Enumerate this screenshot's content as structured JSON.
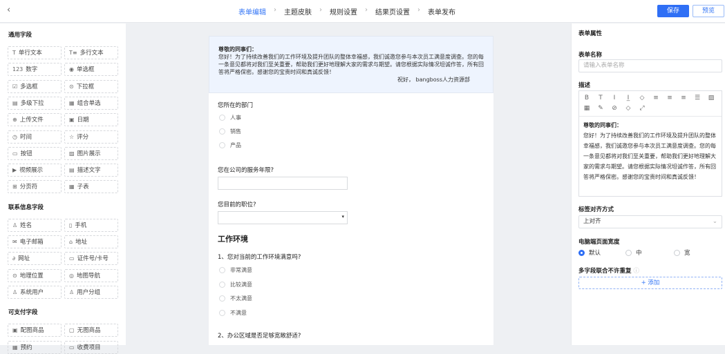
{
  "header": {
    "back": "‹",
    "steps": [
      "表单编辑",
      "主题皮肤",
      "规则设置",
      "结果页设置",
      "表单发布"
    ],
    "save": "保存",
    "preview": "预览"
  },
  "left": {
    "sections": [
      {
        "title": "通用字段",
        "items": [
          [
            "T",
            "单行文本"
          ],
          [
            "T≡",
            "多行文本"
          ],
          [
            "123",
            "数字"
          ],
          [
            "◉",
            "单选框"
          ],
          [
            "☑",
            "多选框"
          ],
          [
            "⊙",
            "下拉框"
          ],
          [
            "▤",
            "多级下拉"
          ],
          [
            "▦",
            "组合单选"
          ],
          [
            "⊕",
            "上传文件"
          ],
          [
            "▣",
            "日期"
          ],
          [
            "◷",
            "时间"
          ],
          [
            "☆",
            "评分"
          ],
          [
            "▭",
            "按钮"
          ],
          [
            "▨",
            "图片展示"
          ],
          [
            "▶",
            "视频展示"
          ],
          [
            "▤",
            "描述文字"
          ],
          [
            "⊞",
            "分页符"
          ],
          [
            "▦",
            "子表"
          ]
        ]
      },
      {
        "title": "联系信息字段",
        "items": [
          [
            "♙",
            "姓名"
          ],
          [
            "▯",
            "手机"
          ],
          [
            "✉",
            "电子邮箱"
          ],
          [
            "⌂",
            "地址"
          ],
          [
            "∂",
            "网址"
          ],
          [
            "▭",
            "证件号/卡号"
          ],
          [
            "⊙",
            "地理位置"
          ],
          [
            "◎",
            "地图导航"
          ],
          [
            "♙",
            "系统用户"
          ],
          [
            "♙",
            "用户分组"
          ]
        ]
      },
      {
        "title": "可支付字段",
        "items": [
          [
            "▣",
            "配图商品"
          ],
          [
            "▢",
            "无图商品"
          ],
          [
            "▦",
            "预约"
          ],
          [
            "▭",
            "收费项目"
          ]
        ]
      }
    ]
  },
  "form": {
    "greeting": "尊敬的同事们：",
    "intro": "您好！为了持续改善我们的工作环境及提升团队的整体幸福感，我们诚邀您参与本次员工满意度调查。您的每一条意见都将对我们至关重要，帮助我们更好地理解大家的需求与期望。请您根据实际情况坦诚作答，所有回答将严格保密。感谢您的宝贵时间和真诚反馈！",
    "signature": "祝好， bangboss人力资源部",
    "q1": "您所在的部门",
    "q1_options": [
      "人事",
      "销售",
      "产品"
    ],
    "q2": "您在公司的服务年限?",
    "q3": "您目前的职位?",
    "section": "工作环境",
    "q4": "1、您对当前的工作环境满意吗?",
    "q4_options": [
      "非常满意",
      "比较满意",
      "不太满意",
      "不满意"
    ],
    "q5": "2、办公区域是否足够宽敞舒适?"
  },
  "right": {
    "title": "表单属性",
    "name_label": "表单名称",
    "name_placeholder": "请输入表单名称",
    "desc_label": "描述",
    "toolbar": [
      "B",
      "T",
      "I",
      "I̲",
      "◇",
      "≡",
      "≡",
      "≡",
      "☰",
      "▨",
      "▦",
      "✎",
      "⊘",
      "◇",
      "⤢"
    ],
    "align_label": "标签对齐方式",
    "align_value": "上对齐",
    "width_label": "电脑端页面宽度",
    "width_options": [
      "默认",
      "中",
      "宽"
    ],
    "unique_label": "多字段联合不许重复",
    "add": "+ 添加"
  }
}
